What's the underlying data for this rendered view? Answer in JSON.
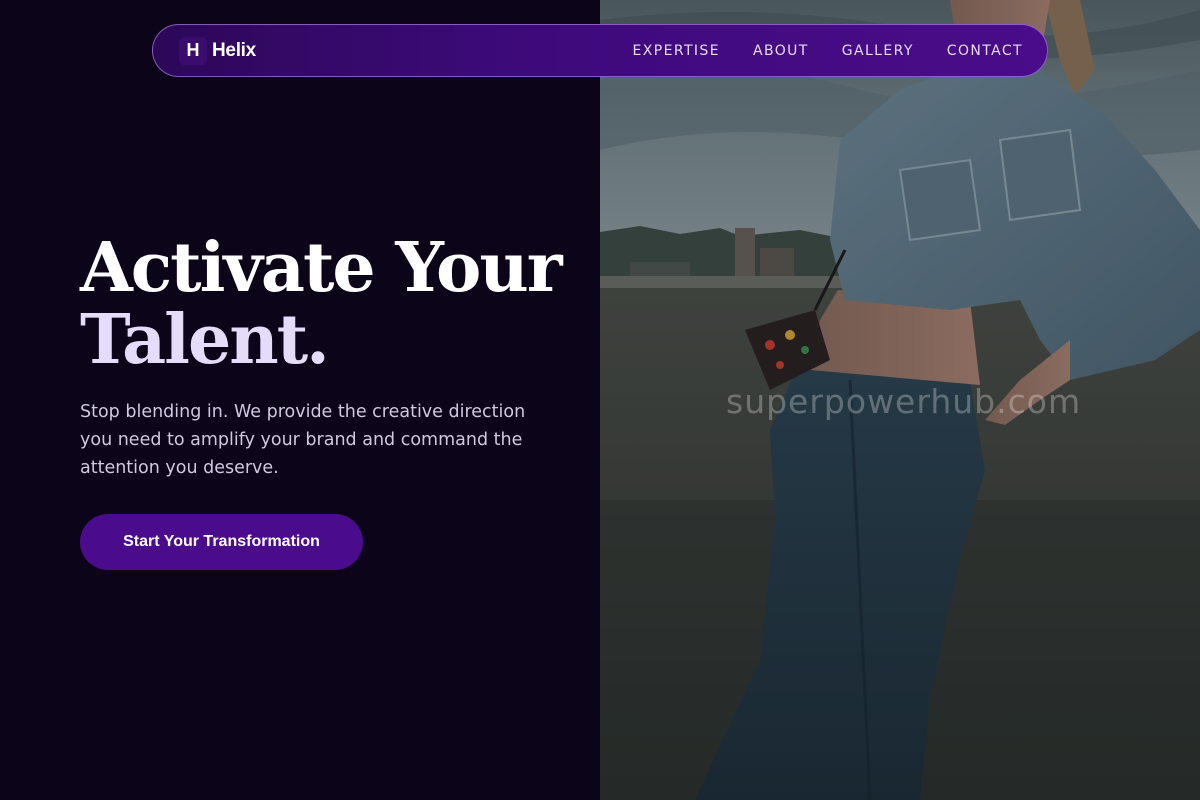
{
  "nav": {
    "brand_mark": "H",
    "brand_name": "Helix",
    "links": [
      {
        "label": "EXPERTISE"
      },
      {
        "label": "ABOUT"
      },
      {
        "label": "GALLERY"
      },
      {
        "label": "CONTACT"
      }
    ]
  },
  "hero": {
    "title_line1": "Activate Your",
    "title_line2": "Talent.",
    "subtitle": "Stop blending in. We provide the creative direction you need to amplify your brand and command the attention you deserve.",
    "cta_label": "Start Your Transformation"
  },
  "photo": {
    "watermark": "superpowerhub.com"
  },
  "colors": {
    "background": "#0c0418",
    "accent": "#4a0c8c",
    "nav_gradient_start": "#2c0858",
    "nav_gradient_end": "#4a0c8a"
  }
}
